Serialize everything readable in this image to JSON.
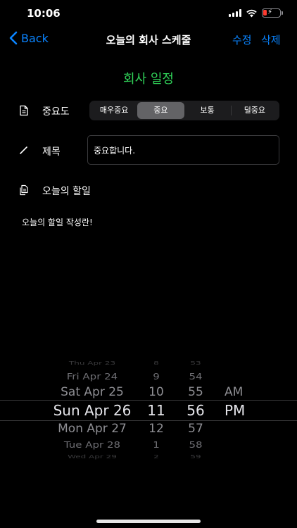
{
  "status_bar": {
    "time": "10:06"
  },
  "nav": {
    "back_label": "Back",
    "title": "오늘의 회사 스케줄",
    "edit_label": "수정",
    "delete_label": "삭제"
  },
  "section_heading": "회사 일정",
  "importance": {
    "label": "중요도",
    "options": [
      "매우중요",
      "중요",
      "보통",
      "덜중요"
    ],
    "selected": "중요"
  },
  "title_field": {
    "label": "제목",
    "value": "중요합니다."
  },
  "todo": {
    "label": "오늘의 할일",
    "content": "오늘의 할일 작성란!"
  },
  "picker": {
    "dates": [
      "Thu Apr 23",
      "Fri Apr 24",
      "Sat Apr 25",
      "Sun Apr 26",
      "Mon Apr 27",
      "Tue Apr 28",
      "Wed Apr 29"
    ],
    "hours": [
      "8",
      "9",
      "10",
      "11",
      "12",
      "1",
      "2"
    ],
    "minutes": [
      "53",
      "54",
      "55",
      "56",
      "57",
      "58",
      "59"
    ],
    "ampm": [
      "",
      "",
      "AM",
      "PM",
      "",
      "",
      ""
    ],
    "selected": {
      "date": "Sun Apr 26",
      "hour": "11",
      "minute": "56",
      "ampm": "PM"
    }
  },
  "colors": {
    "accent": "#0a84ff",
    "heading": "#30d158",
    "background": "#000000",
    "segment_selected": "#636366"
  }
}
